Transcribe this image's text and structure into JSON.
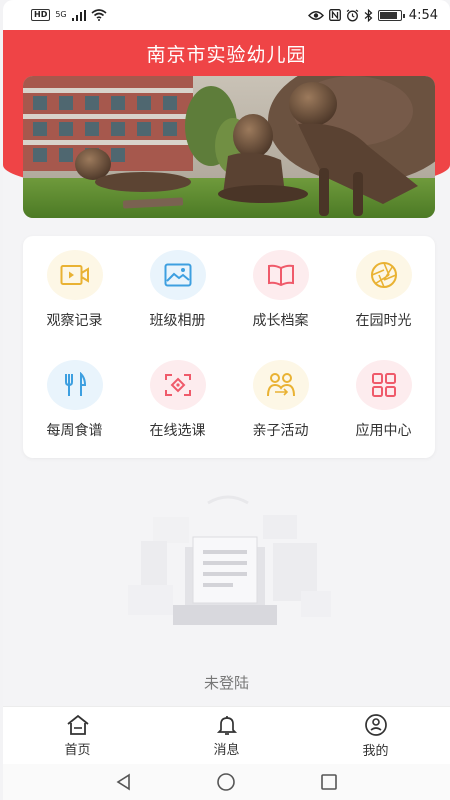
{
  "status_bar": {
    "hd": "HD",
    "network": "5G",
    "time": "4:54",
    "battery_level": 0.8
  },
  "header": {
    "title": "南京市实验幼儿园",
    "accent": "#ef4446"
  },
  "menu": {
    "items": [
      {
        "label": "观察记录",
        "icon": "video-record-icon",
        "color": "#e9b233",
        "bg": "#fdf7e6"
      },
      {
        "label": "班级相册",
        "icon": "photo-album-icon",
        "color": "#3d9fe0",
        "bg": "#e9f4fc"
      },
      {
        "label": "成长档案",
        "icon": "book-icon",
        "color": "#ef5a6a",
        "bg": "#fdecee"
      },
      {
        "label": "在园时光",
        "icon": "aperture-icon",
        "color": "#e9b233",
        "bg": "#fdf7e6"
      },
      {
        "label": "每周食谱",
        "icon": "cutlery-icon",
        "color": "#3d9fe0",
        "bg": "#e9f4fc"
      },
      {
        "label": "在线选课",
        "icon": "scan-target-icon",
        "color": "#ef5a6a",
        "bg": "#fdecee"
      },
      {
        "label": "亲子活动",
        "icon": "parent-child-icon",
        "color": "#e9b233",
        "bg": "#fdf7e6"
      },
      {
        "label": "应用中心",
        "icon": "app-grid-icon",
        "color": "#ef5a6a",
        "bg": "#fdecee"
      }
    ]
  },
  "empty_state": {
    "text": "未登陆"
  },
  "tabbar": {
    "items": [
      {
        "label": "首页",
        "icon": "home-icon"
      },
      {
        "label": "消息",
        "icon": "bell-icon"
      },
      {
        "label": "我的",
        "icon": "user-smile-icon"
      }
    ]
  }
}
